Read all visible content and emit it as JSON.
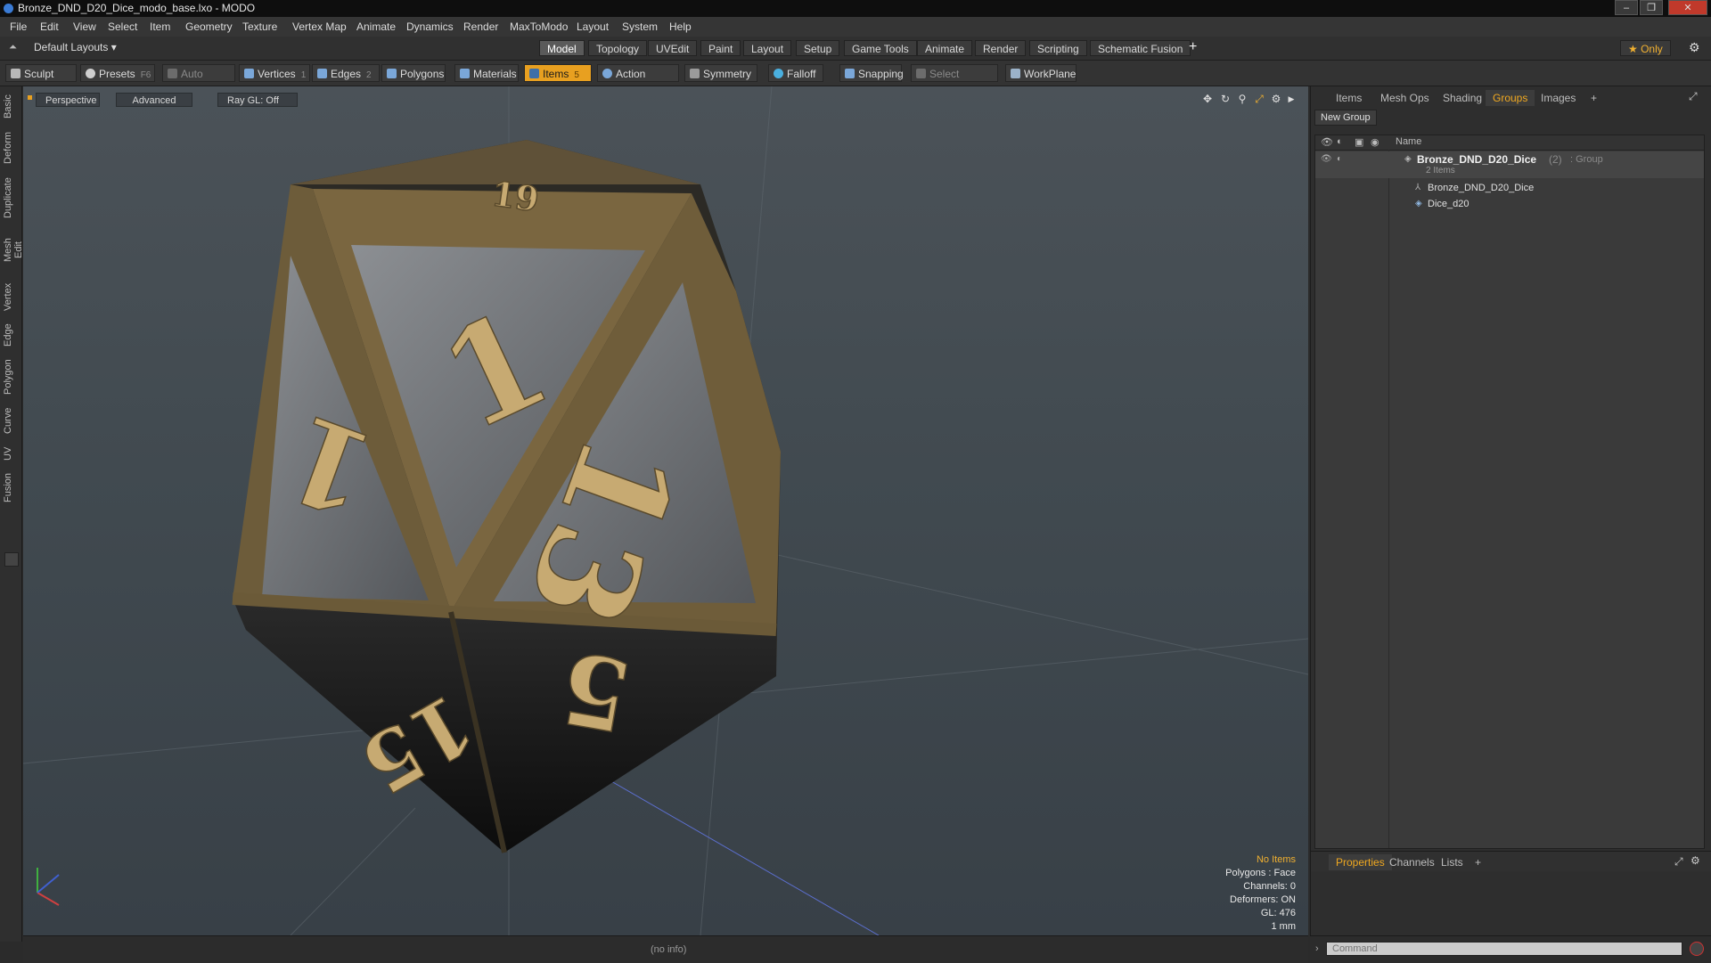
{
  "window": {
    "title": "Bronze_DND_D20_Dice_modo_base.lxo - MODO",
    "minimize": "‒",
    "maximize": "❐",
    "close": "✕"
  },
  "menu": [
    "File",
    "Edit",
    "View",
    "Select",
    "Item",
    "Geometry",
    "Texture",
    "Vertex Map",
    "Animate",
    "Dynamics",
    "Render",
    "MaxToModo",
    "Layout",
    "System",
    "Help"
  ],
  "layouts": {
    "default_label": "Default Layouts ▾",
    "tabs": [
      "Model",
      "Topology",
      "UVEdit",
      "Paint",
      "Layout",
      "Setup",
      "Game Tools",
      "Animate",
      "Render",
      "Scripting",
      "Schematic Fusion"
    ],
    "active_tab": "Model",
    "add": "+",
    "only_label": "★  Only"
  },
  "toolbar": {
    "sculpt": "Sculpt",
    "presets": "Presets",
    "presets_key": "F6",
    "auto_select": "Auto Select",
    "vertices": "Vertices",
    "vertices_count": "1",
    "edges": "Edges",
    "edges_count": "2",
    "polygons": "Polygons",
    "materials": "Materials",
    "items": "Items",
    "items_count": "5",
    "action_center": "Action Center",
    "symmetry": "Symmetry",
    "falloff": "Falloff",
    "snapping": "Snapping",
    "select_through": "Select Through",
    "workplane": "WorkPlane"
  },
  "left_tabs": [
    "Basic",
    "Deform",
    "Duplicate",
    "Mesh Edit",
    "Vertex",
    "Edge",
    "Polygon",
    "Curve",
    "UV",
    "Fusion"
  ],
  "viewport": {
    "view_mode": "Perspective",
    "shading": "Advanced",
    "raygl": "Ray GL: Off",
    "hud": {
      "selection": "No Items",
      "polygons": "Polygons : Face",
      "channels": "Channels: 0",
      "deformers": "Deformers: ON",
      "gl": "GL: 476",
      "unit": "1 mm"
    },
    "numbers": [
      "19",
      "1",
      "13",
      "1",
      "15",
      "5"
    ]
  },
  "right_panel": {
    "tabs": [
      "Items",
      "Mesh Ops",
      "Shading",
      "Groups",
      "Images"
    ],
    "active_tab": "Groups",
    "add": "+",
    "new_group": "New Group",
    "column_name": "Name",
    "group": {
      "name": "Bronze_DND_D20_Dice",
      "count": "(2)",
      "type": ": Group",
      "subtitle": "2 Items"
    },
    "children": [
      "Bronze_DND_D20_Dice",
      "Dice_d20"
    ],
    "bottom_tabs": [
      "Properties",
      "Channels",
      "Lists"
    ],
    "bottom_active": "Properties"
  },
  "status": {
    "info": "(no info)",
    "command_placeholder": "Command"
  },
  "colors": {
    "accent": "#e8a020",
    "bronze": "#8a7448",
    "viewport_bg": "#434b51"
  }
}
